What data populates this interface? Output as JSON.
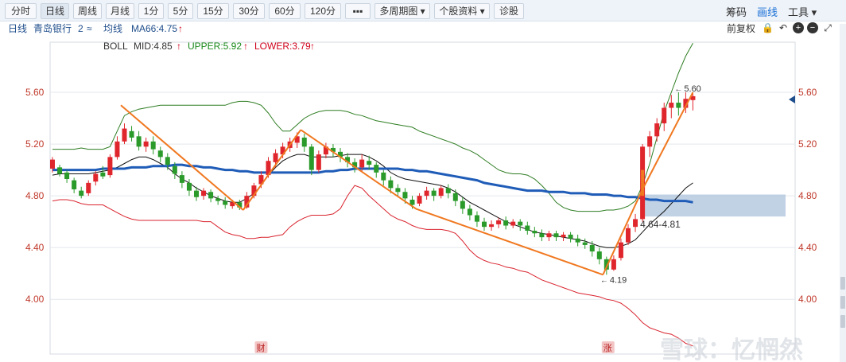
{
  "toolbar": {
    "buttons": [
      "分时",
      "日线",
      "周线",
      "月线",
      "1分",
      "5分",
      "15分",
      "30分",
      "60分",
      "120分",
      "▪▪▪",
      "多周期图 ▾",
      "个股资料 ▾",
      "诊股"
    ],
    "active_index": 1,
    "right": [
      "筹码",
      "画线",
      "工具 ▾"
    ],
    "right_active_index": 1
  },
  "infobar": {
    "period": "日线",
    "stock_name": "青岛银行",
    "count": "2",
    "count_arrows": "≈",
    "ma_label": "均线",
    "adjust": "前复权",
    "icons": [
      "lock-icon",
      "undo-icon",
      "zoom-in-icon",
      "zoom-out-icon",
      "expand-icon"
    ],
    "icon_glyphs": [
      "🔒",
      "↶",
      "+",
      "−",
      "⤢"
    ]
  },
  "legend": {
    "boll": "BOLL",
    "mid": "MID:4.85",
    "upper": "UPPER:5.92",
    "lower": "LOWER:3.79",
    "ma66": "MA66:4.75",
    "arrow": "↑",
    "colors": {
      "boll": "#333333",
      "mid": "#333333",
      "upper": "#1a8a1a",
      "lower": "#d0021b",
      "ma66": "#1f4e8c",
      "arrow": "#d0021b"
    }
  },
  "chart_data": {
    "type": "candlestick",
    "y_ticks": [
      "5.60",
      "5.20",
      "4.80",
      "4.40",
      "4.00"
    ],
    "ylim": [
      3.62,
      6.0
    ],
    "grid": true,
    "colors": {
      "up": "#e0262d",
      "down": "#2a9a2a",
      "upper": "#2e7d22",
      "lower": "#d9232e",
      "mid": "#111111",
      "ma66": "#1f5cb8",
      "trend": "#f07820",
      "zone": "#aec3dc",
      "axis_text": "#c0392b",
      "grid": "#e4e7ec"
    },
    "candles": [
      [
        5.01,
        5.08,
        4.98,
        5.1
      ],
      [
        5.02,
        4.97,
        4.95,
        5.04
      ],
      [
        4.98,
        4.93,
        4.9,
        5.0
      ],
      [
        4.92,
        4.85,
        4.82,
        4.94
      ],
      [
        4.84,
        4.8,
        4.78,
        4.87
      ],
      [
        4.82,
        4.9,
        4.8,
        4.92
      ],
      [
        4.91,
        4.97,
        4.88,
        4.99
      ],
      [
        4.98,
        4.95,
        4.93,
        5.03
      ],
      [
        4.96,
        5.1,
        4.94,
        5.12
      ],
      [
        5.1,
        5.22,
        5.08,
        5.26
      ],
      [
        5.22,
        5.32,
        5.2,
        5.36
      ],
      [
        5.3,
        5.25,
        5.22,
        5.34
      ],
      [
        5.26,
        5.18,
        5.15,
        5.3
      ],
      [
        5.18,
        5.22,
        5.14,
        5.25
      ],
      [
        5.22,
        5.16,
        5.12,
        5.26
      ],
      [
        5.15,
        5.1,
        5.06,
        5.18
      ],
      [
        5.1,
        5.04,
        5.0,
        5.13
      ],
      [
        5.03,
        4.97,
        4.93,
        5.06
      ],
      [
        4.96,
        4.9,
        4.86,
        4.99
      ],
      [
        4.9,
        4.84,
        4.8,
        4.93
      ],
      [
        4.84,
        4.79,
        4.76,
        4.87
      ],
      [
        4.8,
        4.84,
        4.77,
        4.86
      ],
      [
        4.83,
        4.78,
        4.75,
        4.85
      ],
      [
        4.78,
        4.76,
        4.73,
        4.8
      ],
      [
        4.76,
        4.73,
        4.7,
        4.79
      ],
      [
        4.72,
        4.75,
        4.7,
        4.77
      ],
      [
        4.75,
        4.71,
        4.69,
        4.77
      ],
      [
        4.71,
        4.8,
        4.7,
        4.83
      ],
      [
        4.8,
        4.88,
        4.78,
        4.9
      ],
      [
        4.89,
        4.96,
        4.86,
        4.99
      ],
      [
        4.96,
        5.07,
        4.94,
        5.1
      ],
      [
        5.06,
        5.13,
        5.02,
        5.16
      ],
      [
        5.12,
        5.18,
        5.09,
        5.21
      ],
      [
        5.17,
        5.22,
        5.14,
        5.25
      ],
      [
        5.21,
        5.26,
        5.17,
        5.29
      ],
      [
        5.25,
        5.18,
        5.14,
        5.28
      ],
      [
        5.18,
        5.0,
        4.96,
        5.2
      ],
      [
        5.0,
        5.12,
        4.98,
        5.15
      ],
      [
        5.12,
        5.18,
        5.09,
        5.21
      ],
      [
        5.17,
        5.14,
        5.1,
        5.2
      ],
      [
        5.14,
        5.1,
        5.06,
        5.17
      ],
      [
        5.1,
        5.06,
        5.02,
        5.13
      ],
      [
        5.06,
        5.02,
        4.98,
        5.09
      ],
      [
        5.02,
        5.08,
        4.99,
        5.12
      ],
      [
        5.07,
        5.04,
        5.0,
        5.11
      ],
      [
        5.04,
        4.98,
        4.94,
        5.06
      ],
      [
        4.98,
        4.92,
        4.88,
        5.0
      ],
      [
        4.92,
        4.86,
        4.82,
        4.95
      ],
      [
        4.86,
        4.83,
        4.79,
        4.89
      ],
      [
        4.83,
        4.78,
        4.74,
        4.86
      ],
      [
        4.77,
        4.73,
        4.7,
        4.8
      ],
      [
        4.74,
        4.8,
        4.72,
        4.82
      ],
      [
        4.8,
        4.84,
        4.77,
        4.87
      ],
      [
        4.84,
        4.8,
        4.76,
        4.86
      ],
      [
        4.8,
        4.86,
        4.78,
        4.88
      ],
      [
        4.86,
        4.82,
        4.78,
        4.89
      ],
      [
        4.82,
        4.76,
        4.72,
        4.85
      ],
      [
        4.76,
        4.7,
        4.66,
        4.79
      ],
      [
        4.7,
        4.65,
        4.61,
        4.73
      ],
      [
        4.65,
        4.6,
        4.56,
        4.68
      ],
      [
        4.6,
        4.56,
        4.53,
        4.63
      ],
      [
        4.56,
        4.58,
        4.53,
        4.61
      ],
      [
        4.58,
        4.61,
        4.55,
        4.63
      ],
      [
        4.61,
        4.57,
        4.54,
        4.64
      ],
      [
        4.57,
        4.6,
        4.55,
        4.62
      ],
      [
        4.6,
        4.57,
        4.53,
        4.62
      ],
      [
        4.57,
        4.53,
        4.5,
        4.6
      ],
      [
        4.53,
        4.51,
        4.48,
        4.56
      ],
      [
        4.51,
        4.48,
        4.45,
        4.54
      ],
      [
        4.48,
        4.51,
        4.45,
        4.53
      ],
      [
        4.51,
        4.48,
        4.45,
        4.53
      ],
      [
        4.48,
        4.5,
        4.45,
        4.52
      ],
      [
        4.5,
        4.47,
        4.44,
        4.52
      ],
      [
        4.47,
        4.44,
        4.41,
        4.5
      ],
      [
        4.44,
        4.42,
        4.39,
        4.47
      ],
      [
        4.42,
        4.37,
        4.33,
        4.45
      ],
      [
        4.37,
        4.31,
        4.27,
        4.4
      ],
      [
        4.31,
        4.23,
        4.19,
        4.33
      ],
      [
        4.23,
        4.31,
        4.22,
        4.34
      ],
      [
        4.32,
        4.44,
        4.3,
        4.47
      ],
      [
        4.44,
        4.55,
        4.42,
        4.58
      ],
      [
        4.56,
        4.62,
        4.52,
        4.66
      ],
      [
        4.62,
        5.18,
        4.6,
        5.2
      ],
      [
        5.18,
        5.26,
        5.1,
        5.3
      ],
      [
        5.26,
        5.36,
        5.22,
        5.4
      ],
      [
        5.36,
        5.48,
        5.3,
        5.52
      ],
      [
        5.48,
        5.52,
        5.4,
        5.58
      ],
      [
        5.52,
        5.48,
        5.42,
        5.6
      ],
      [
        5.48,
        5.55,
        5.44,
        5.6
      ],
      [
        5.54,
        5.57,
        5.46,
        5.6
      ]
    ],
    "upper": [
      5.16,
      5.16,
      5.16,
      5.16,
      5.17,
      5.16,
      5.16,
      5.16,
      5.18,
      5.3,
      5.42,
      5.45,
      5.47,
      5.48,
      5.49,
      5.5,
      5.5,
      5.5,
      5.5,
      5.5,
      5.5,
      5.5,
      5.5,
      5.5,
      5.5,
      5.52,
      5.53,
      5.53,
      5.52,
      5.5,
      5.44,
      5.36,
      5.3,
      5.3,
      5.35,
      5.4,
      5.43,
      5.45,
      5.46,
      5.46,
      5.46,
      5.45,
      5.43,
      5.42,
      5.4,
      5.38,
      5.37,
      5.36,
      5.35,
      5.34,
      5.33,
      5.3,
      5.28,
      5.26,
      5.24,
      5.22,
      5.2,
      5.17,
      5.15,
      5.12,
      5.08,
      5.04,
      5.0,
      4.98,
      4.97,
      4.97,
      4.96,
      4.93,
      4.88,
      4.82,
      4.75,
      4.71,
      4.69,
      4.68,
      4.68,
      4.68,
      4.68,
      4.69,
      4.69,
      4.7,
      4.72,
      4.76,
      4.88,
      5.05,
      5.25,
      5.45,
      5.6,
      5.75,
      5.88,
      5.98
    ],
    "mid": [
      4.96,
      4.97,
      4.97,
      4.97,
      4.97,
      4.97,
      4.98,
      4.99,
      5.0,
      5.02,
      5.05,
      5.08,
      5.1,
      5.1,
      5.08,
      5.05,
      5.02,
      4.97,
      4.93,
      4.9,
      4.86,
      4.83,
      4.8,
      4.78,
      4.76,
      4.75,
      4.75,
      4.78,
      4.82,
      4.88,
      4.96,
      5.02,
      5.07,
      5.1,
      5.12,
      5.12,
      5.1,
      5.1,
      5.1,
      5.1,
      5.11,
      5.12,
      5.12,
      5.12,
      5.1,
      5.07,
      5.03,
      4.98,
      4.95,
      4.93,
      4.92,
      4.91,
      4.9,
      4.89,
      4.88,
      4.86,
      4.83,
      4.79,
      4.75,
      4.72,
      4.69,
      4.66,
      4.63,
      4.6,
      4.58,
      4.56,
      4.54,
      4.52,
      4.51,
      4.5,
      4.49,
      4.48,
      4.47,
      4.46,
      4.45,
      4.43,
      4.41,
      4.4,
      4.4,
      4.41,
      4.43,
      4.46,
      4.52,
      4.58,
      4.63,
      4.68,
      4.74,
      4.8,
      4.86,
      4.9
    ],
    "lower": [
      4.76,
      4.77,
      4.77,
      4.76,
      4.74,
      4.73,
      4.73,
      4.73,
      4.7,
      4.67,
      4.64,
      4.62,
      4.61,
      4.61,
      4.61,
      4.61,
      4.61,
      4.61,
      4.61,
      4.61,
      4.61,
      4.6,
      4.6,
      4.56,
      4.52,
      4.5,
      4.49,
      4.47,
      4.47,
      4.48,
      4.48,
      4.49,
      4.5,
      4.56,
      4.6,
      4.63,
      4.65,
      4.65,
      4.65,
      4.66,
      4.7,
      4.8,
      4.88,
      4.86,
      4.8,
      4.75,
      4.7,
      4.65,
      4.62,
      4.6,
      4.57,
      4.55,
      4.54,
      4.54,
      4.54,
      4.53,
      4.51,
      4.45,
      4.38,
      4.33,
      4.3,
      4.28,
      4.27,
      4.25,
      4.24,
      4.22,
      4.21,
      4.18,
      4.15,
      4.13,
      4.11,
      4.09,
      4.07,
      4.05,
      4.04,
      4.03,
      4.02,
      4.0,
      3.99,
      3.97,
      3.93,
      3.88,
      3.82,
      3.78,
      3.76,
      3.74,
      3.73,
      3.7,
      3.66,
      3.64
    ],
    "ma66": [
      5.0,
      5.0,
      5.0,
      5.0,
      5.0,
      5.0,
      5.0,
      5.01,
      5.01,
      5.01,
      5.01,
      5.02,
      5.02,
      5.02,
      5.03,
      5.03,
      5.03,
      5.04,
      5.04,
      5.03,
      5.03,
      5.02,
      5.02,
      5.01,
      5.0,
      5.0,
      4.99,
      4.99,
      4.98,
      4.98,
      4.98,
      4.98,
      4.98,
      4.98,
      4.98,
      4.98,
      4.98,
      4.98,
      4.99,
      4.99,
      5.0,
      5.0,
      5.01,
      5.01,
      5.01,
      5.01,
      5.01,
      5.01,
      5.01,
      5.0,
      5.0,
      4.99,
      4.99,
      4.98,
      4.97,
      4.96,
      4.95,
      4.94,
      4.93,
      4.92,
      4.9,
      4.89,
      4.88,
      4.87,
      4.86,
      4.85,
      4.84,
      4.84,
      4.84,
      4.83,
      4.83,
      4.83,
      4.82,
      4.82,
      4.82,
      4.81,
      4.81,
      4.81,
      4.8,
      4.8,
      4.79,
      4.79,
      4.78,
      4.77,
      4.77,
      4.76,
      4.76,
      4.76,
      4.76,
      4.75
    ],
    "trend_lines": [
      [
        [
          9.5,
          5.5
        ],
        [
          26.5,
          4.69
        ]
      ],
      [
        [
          26.5,
          4.69
        ],
        [
          34.5,
          5.31
        ]
      ],
      [
        [
          34.5,
          5.31
        ],
        [
          50.5,
          4.7
        ]
      ],
      [
        [
          50.5,
          4.7
        ],
        [
          76.5,
          4.19
        ]
      ],
      [
        [
          76.5,
          4.19
        ],
        [
          82,
          4.85
        ]
      ],
      [
        [
          82,
          4.85
        ],
        [
          89,
          5.6
        ]
      ]
    ],
    "zone": {
      "from_index": 82,
      "y1": 4.64,
      "y2": 4.81
    },
    "annotations": {
      "high": "5.60",
      "low": "4.19",
      "zone": "4.64-4.81",
      "high_arrow": "←",
      "low_arrow": "←"
    },
    "markers": {
      "fin_label": "财",
      "fin_index": 29,
      "up_label": "涨",
      "up_index": 76
    },
    "watermark": "雪球：忆惘然"
  }
}
